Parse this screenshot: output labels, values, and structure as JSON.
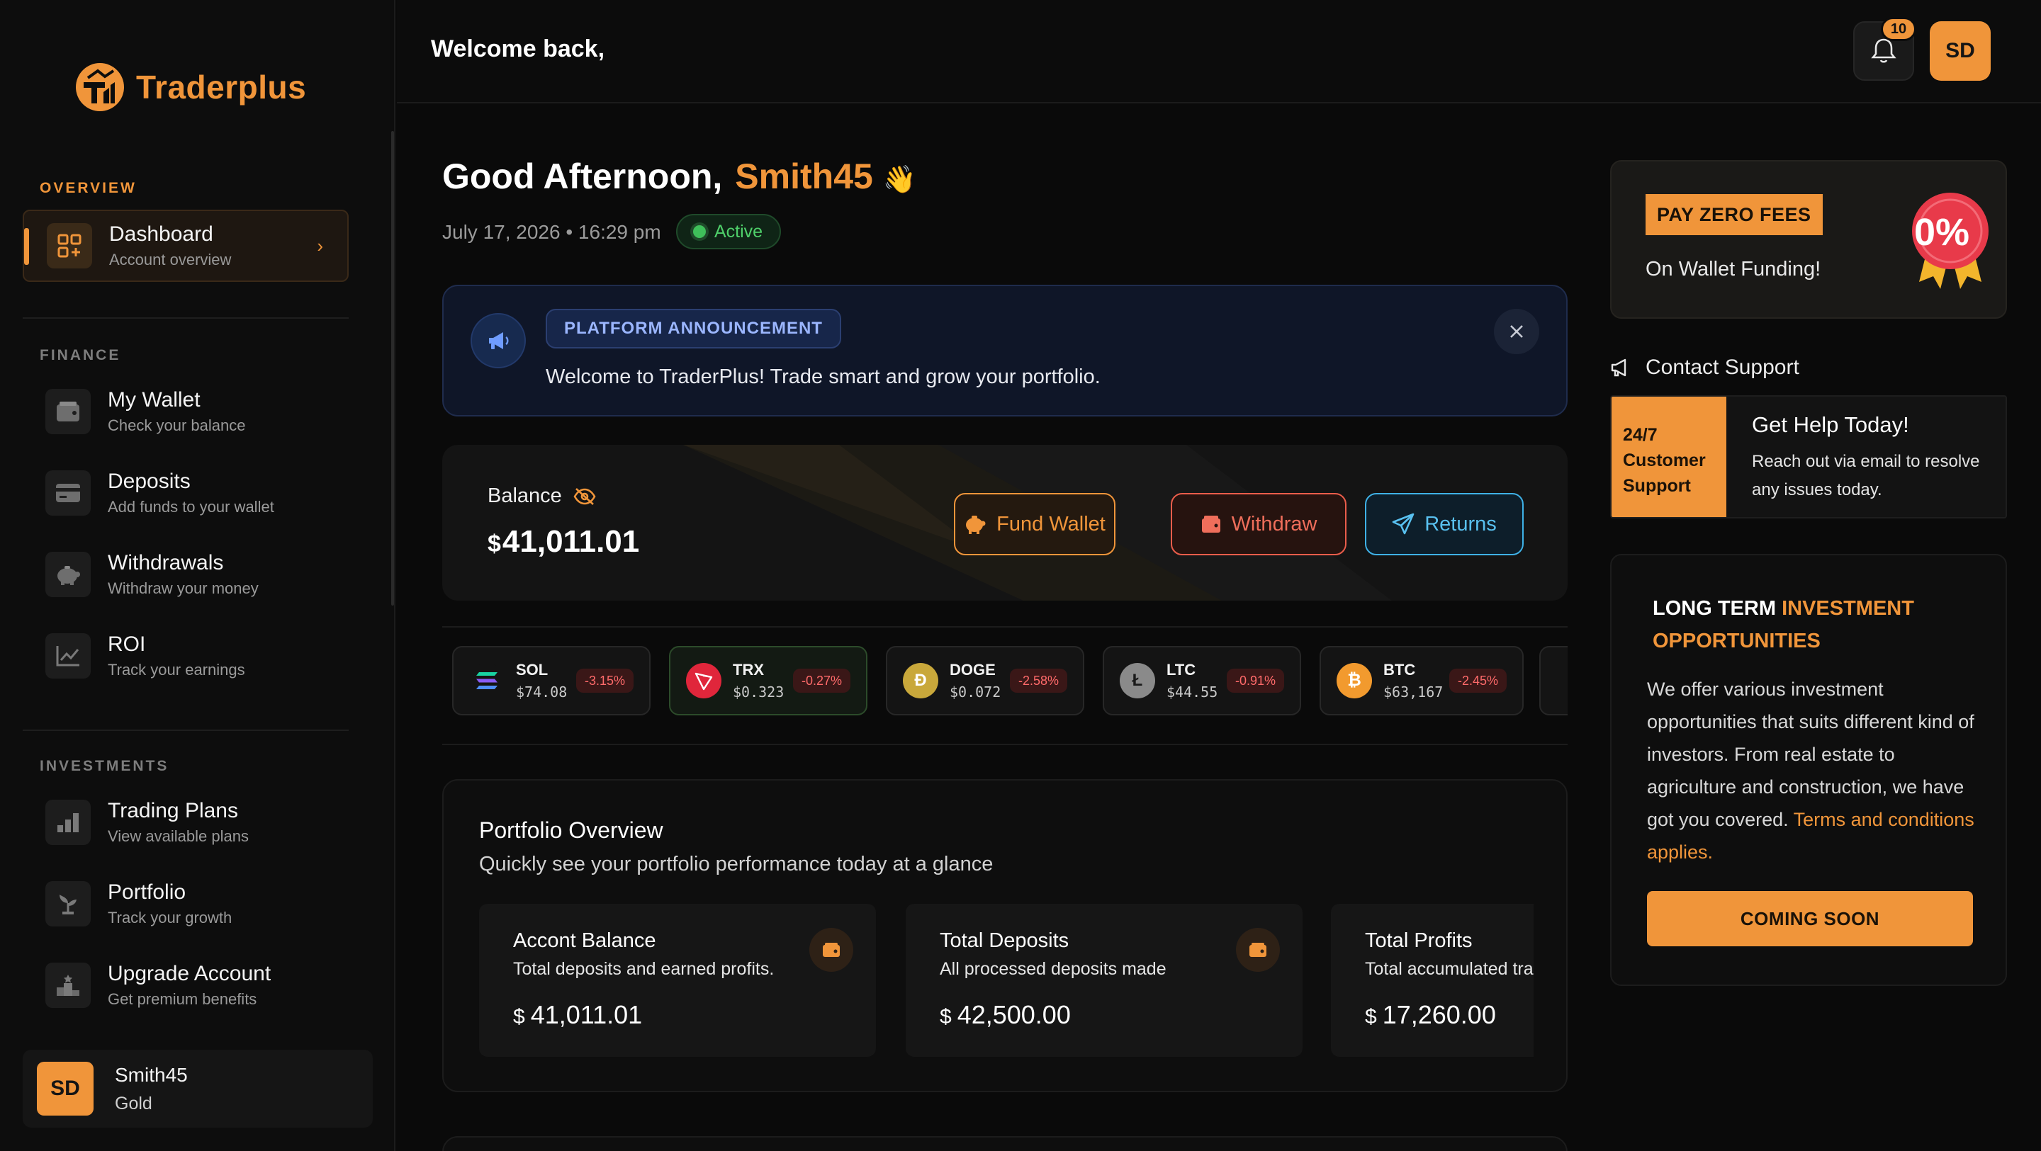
{
  "brand": {
    "name": "Traderplus",
    "accent": "#f0953a"
  },
  "sidebar": {
    "sections": [
      {
        "label": "OVERVIEW"
      },
      {
        "label": "FINANCE"
      },
      {
        "label": "INVESTMENTS"
      }
    ],
    "items": [
      {
        "title": "Dashboard",
        "sub": "Account overview",
        "icon": "dashboard-grid-icon",
        "active": true
      },
      {
        "title": "My Wallet",
        "sub": "Check your balance",
        "icon": "wallet-icon"
      },
      {
        "title": "Deposits",
        "sub": "Add funds to your wallet",
        "icon": "credit-card-icon"
      },
      {
        "title": "Withdrawals",
        "sub": "Withdraw your money",
        "icon": "piggy-bank-icon"
      },
      {
        "title": "ROI",
        "sub": "Track your earnings",
        "icon": "line-chart-icon"
      },
      {
        "title": "Trading Plans",
        "sub": "View available plans",
        "icon": "bar-chart-icon"
      },
      {
        "title": "Portfolio",
        "sub": "Track your growth",
        "icon": "plant-icon"
      },
      {
        "title": "Upgrade Account",
        "sub": "Get premium benefits",
        "icon": "podium-icon"
      }
    ],
    "profile": {
      "initials": "SD",
      "name": "Smith45",
      "tier": "Gold"
    }
  },
  "topbar": {
    "welcome": "Welcome back,",
    "notifications": "10",
    "avatar_initials": "SD"
  },
  "greeting": {
    "prefix": "Good Afternoon,",
    "username": "Smith45",
    "emoji": "👋",
    "datetime": "July 17, 2026 • 16:29 pm",
    "status": "Active"
  },
  "announcement": {
    "tag": "PLATFORM ANNOUNCEMENT",
    "text": "Welcome to TraderPlus! Trade smart and grow your portfolio."
  },
  "balance": {
    "label": "Balance",
    "currency": "$",
    "amount": "41,011.01",
    "buttons": {
      "fund": "Fund Wallet",
      "withdraw": "Withdraw",
      "returns": "Returns"
    }
  },
  "tickers": [
    {
      "symbol": "SOL",
      "price": "$74.08",
      "change": "-3.15%"
    },
    {
      "symbol": "TRX",
      "price": "$0.323",
      "change": "-0.27%"
    },
    {
      "symbol": "DOGE",
      "price": "$0.072",
      "change": "-2.58%"
    },
    {
      "symbol": "LTC",
      "price": "$44.55",
      "change": "-0.91%"
    },
    {
      "symbol": "BTC",
      "price": "$63,167",
      "change": "-2.45%"
    }
  ],
  "portfolio": {
    "title": "Portfolio Overview",
    "subtitle": "Quickly see your portfolio performance today at a glance",
    "cards": [
      {
        "title": "Accont Balance",
        "sub": "Total deposits and earned profits.",
        "currency": "$",
        "value": "41,011.01"
      },
      {
        "title": "Total Deposits",
        "sub": "All processed deposits made",
        "currency": "$",
        "value": "42,500.00"
      },
      {
        "title": "Total Profits",
        "sub": "Total accumulated trading profits",
        "currency": "$",
        "value": "17,260.00"
      }
    ]
  },
  "promo": {
    "tag": "PAY ZERO FEES",
    "sub": "On Wallet Funding!",
    "badge": "0%"
  },
  "contact": {
    "heading": "Contact Support",
    "badge_line1": "24/7",
    "badge_line2": "Customer",
    "badge_line3": "Support",
    "title": "Get Help Today!",
    "body": "Reach out via email to resolve any issues today."
  },
  "invest": {
    "title_white": "LONG TERM",
    "title_accent": "INVESTMENT OPPORTUNITIES",
    "body": "We offer various investment opportunities that suits different kind of investors. From real estate to agriculture and construction, we have got you covered.",
    "link": "Terms and conditions applies.",
    "button": "COMING SOON"
  }
}
